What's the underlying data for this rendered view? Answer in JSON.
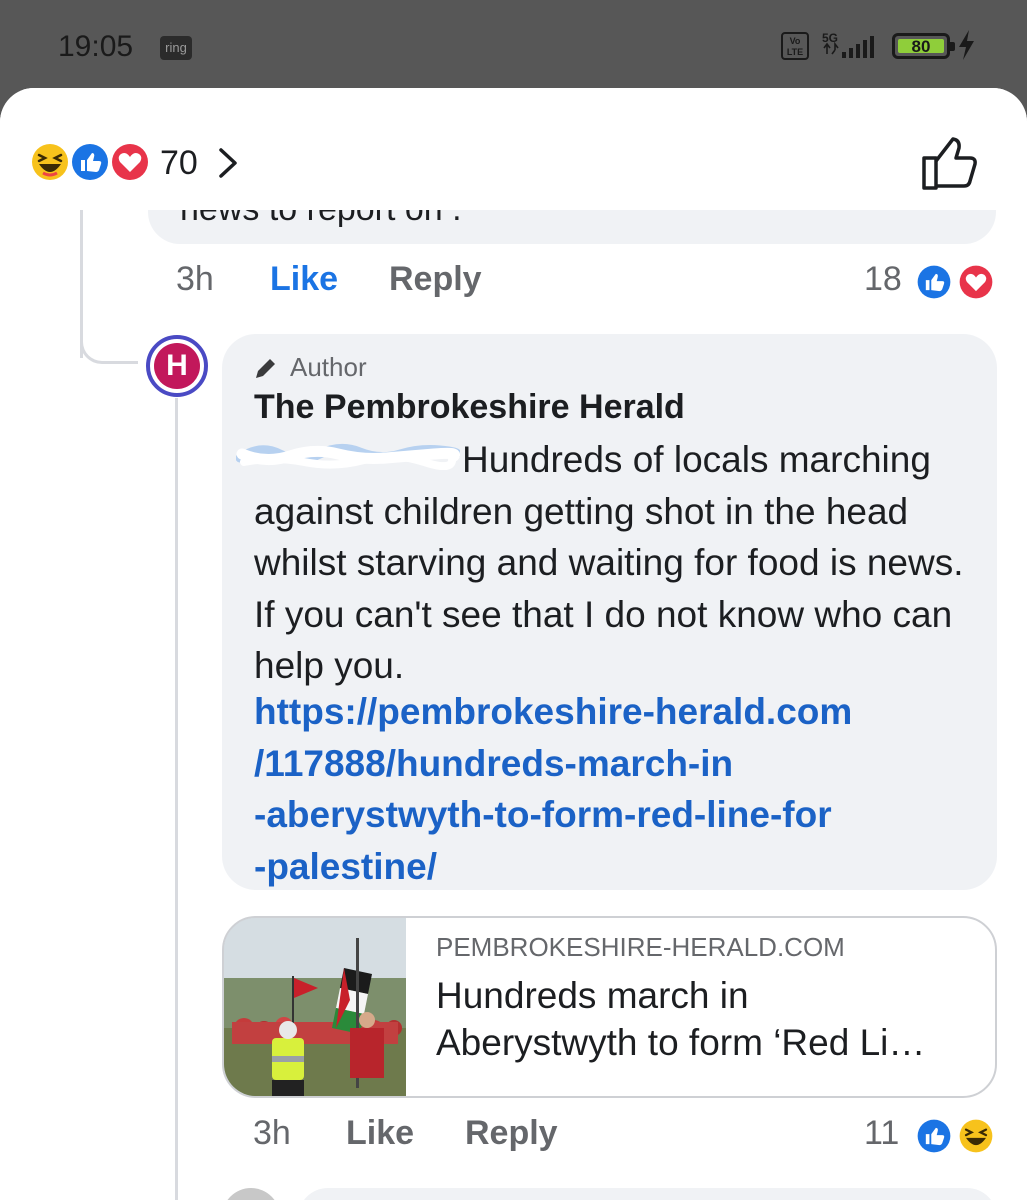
{
  "status_bar": {
    "time": "19:05",
    "ring_label": "ring",
    "volte_label": "Vo LTE",
    "network": "5G",
    "battery_level": "80"
  },
  "reactions_summary": {
    "count": "70",
    "icons": [
      "haha-icon",
      "like-icon",
      "love-icon"
    ]
  },
  "previous_comment": {
    "text_fragment": "news to report on .",
    "time": "3h",
    "like_label": "Like",
    "reply_label": "Reply",
    "reaction_count": "18",
    "reaction_icons": [
      "like-icon",
      "love-icon"
    ]
  },
  "author_reply": {
    "avatar_letter": "H",
    "badge": "Author",
    "author_name": "The Pembrokeshire Herald",
    "body": "Hundreds of locals marching against children getting shot in the head whilst starving and waiting for food is news. If you can't see that I do not know who can help you.",
    "link_lines": [
      "https://pembrokeshire-herald.com",
      "/117888/hundreds-march-in",
      "-aberystwyth-to-form-red-line-for",
      "-palestine/"
    ],
    "preview": {
      "domain": "PEMBROKESHIRE-HERALD.COM",
      "title_line1": "Hundreds march in",
      "title_line2": "Aberystwyth to form ‘Red Li…"
    },
    "time": "3h",
    "like_label": "Like",
    "reply_label": "Reply",
    "reaction_count": "11",
    "reaction_icons": [
      "like-icon",
      "haha-icon"
    ]
  },
  "colors": {
    "link": "#1b62c6",
    "like_active": "#1b74e4",
    "bubble": "#f0f2f5",
    "secondary_text": "#65676b"
  }
}
